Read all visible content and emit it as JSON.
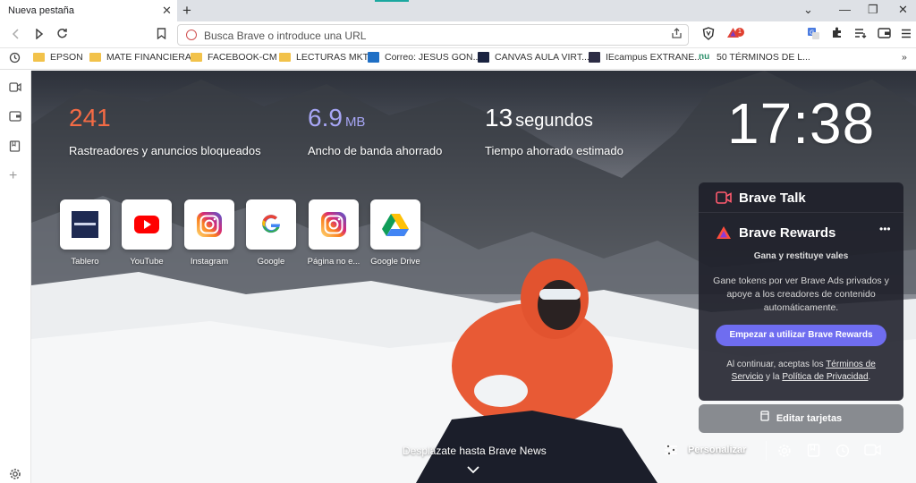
{
  "tab": {
    "title": "Nueva pestaña",
    "close": "✕",
    "new": "+"
  },
  "window": {
    "minimize": "⌄",
    "min2": "—",
    "restore": "❐",
    "close": "✕"
  },
  "omnibox": {
    "placeholder": "Busca Brave o introduce una URL",
    "share_icon": "share-icon"
  },
  "bookmarks": [
    {
      "label": "EPSON",
      "type": "folder"
    },
    {
      "label": "MATE FINANCIERA",
      "type": "folder"
    },
    {
      "label": "FACEBOOK-CM",
      "type": "folder"
    },
    {
      "label": "LECTURAS MKT",
      "type": "folder"
    },
    {
      "label": "Correo: JESUS GON...",
      "type": "outlook"
    },
    {
      "label": "CANVAS AULA VIRT...",
      "type": "canvas"
    },
    {
      "label": "IEcampus EXTRANE...",
      "type": "iecampus"
    },
    {
      "label": "50 TÉRMINOS DE L...",
      "type": "nu"
    }
  ],
  "stats": [
    {
      "value": "241",
      "unit": "",
      "label": "Rastreadores y anuncios bloqueados",
      "color": "#f46b45"
    },
    {
      "value": "6.9",
      "unit": "MB",
      "label": "Ancho de banda ahorrado",
      "color": "#a7a6f5"
    },
    {
      "value": "13",
      "unit": "segundos",
      "label": "Tiempo ahorrado estimado",
      "color": "#ffffff"
    }
  ],
  "clock": "17:38",
  "tiles": [
    {
      "label": "Tablero",
      "icon": "tablero-icon"
    },
    {
      "label": "YouTube",
      "icon": "youtube-icon"
    },
    {
      "label": "Instagram",
      "icon": "instagram-icon"
    },
    {
      "label": "Google",
      "icon": "google-icon"
    },
    {
      "label": "Página no e...",
      "icon": "instagram-icon"
    },
    {
      "label": "Google Drive",
      "icon": "google-drive-icon"
    }
  ],
  "brave_talk": {
    "title": "Brave Talk"
  },
  "brave_rewards": {
    "title": "Brave Rewards",
    "more": "•••",
    "subtitle": "Gana y restituye vales",
    "description": "Gane tokens por ver Brave Ads privados y apoye a los creadores de contenido automáticamente.",
    "button": "Empezar a utilizar Brave Rewards",
    "terms_prefix": "Al continuar, aceptas los ",
    "terms_link": "Términos de Servicio",
    "terms_mid": " y la ",
    "privacy_link": "Política de Privacidad",
    "terms_suffix": "."
  },
  "edit_cards": "Editar tarjetas",
  "bottom": {
    "news": "Desplázate hasta Brave News",
    "customize": "Personalizar"
  },
  "colors": {
    "rewards_button": "#6f6df0",
    "stat_trackers": "#f46b45",
    "stat_bandwidth": "#a7a6f5"
  }
}
